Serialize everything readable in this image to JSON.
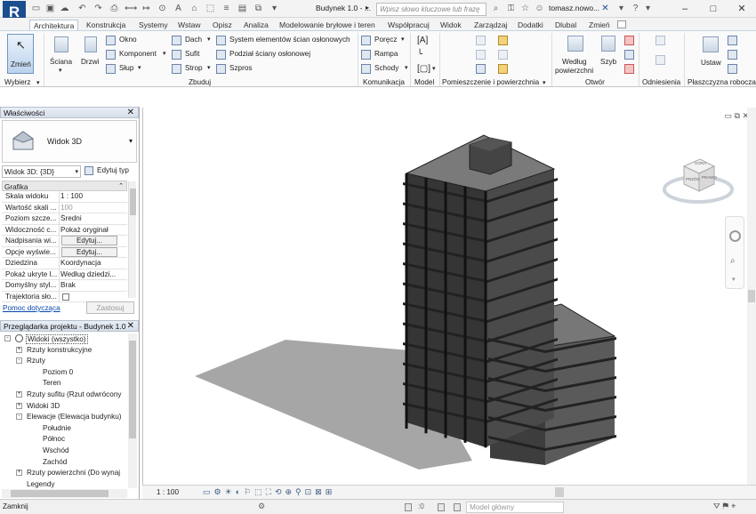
{
  "titlebar": {
    "document_title": "Budynek 1.0 - ...",
    "search_placeholder": "Wpisz słowo kluczowe lub frazę",
    "user": "tomasz.nowo...",
    "help": "?",
    "minimize": "–",
    "maximize": "□",
    "close": "✕"
  },
  "tabs": [
    "Architektura",
    "Konstrukcja",
    "Systemy",
    "Wstaw",
    "Opisz",
    "Analiza",
    "Modelowanie bryłowe i teren",
    "Współpracuj",
    "Widok",
    "Zarządzaj",
    "Dodatki",
    "Dlubal",
    "Zmień"
  ],
  "ribbon": {
    "modify": "Zmień",
    "wall": "Ściana",
    "door": "Drzwi",
    "window": "Okno",
    "component": "Komponent",
    "column": "Słup",
    "roof": "Dach",
    "ceiling": "Sufit",
    "floor": "Strop",
    "curtain_system": "System elementów ścian osłonowych",
    "curtain_grid": "Podział ściany osłonowej",
    "mullion": "Szpros",
    "railing": "Poręcz",
    "ramp": "Rampa",
    "stair": "Schody",
    "by_face": "Według",
    "by_face2": "powierzchni",
    "shaft": "Szyb",
    "set": "Ustaw",
    "groups": {
      "select": "Wybierz",
      "build": "Zbuduj",
      "circulation": "Komunikacja",
      "model": "Model",
      "room_area": "Pomieszczenie i powierzchnia",
      "opening": "Otwór",
      "datum": "Odniesienia",
      "work_plane": "Płaszczyzna robocza"
    }
  },
  "properties": {
    "title": "Właściwości",
    "type_name": "Widok 3D",
    "instance_selector": "Widok 3D: {3D}",
    "edit_type": "Edytuj typ",
    "section": "Grafika",
    "rows": [
      {
        "key": "Skala widoku",
        "value": "1 : 100",
        "kind": "text"
      },
      {
        "key": "Wartość skali ...",
        "value": "100",
        "kind": "grey"
      },
      {
        "key": "Poziom szcze...",
        "value": "Średni",
        "kind": "text"
      },
      {
        "key": "Widoczność c...",
        "value": "Pokaż oryginał",
        "kind": "text"
      },
      {
        "key": "Nadpisania wi...",
        "value": "Edytuj...",
        "kind": "button"
      },
      {
        "key": "Opcje wyświe...",
        "value": "Edytuj...",
        "kind": "button"
      },
      {
        "key": "Dziedzina",
        "value": "Koordynacja",
        "kind": "text"
      },
      {
        "key": "Pokaż ukryte l...",
        "value": "Według dziedzi...",
        "kind": "text"
      },
      {
        "key": "Domyślny styl...",
        "value": "Brak",
        "kind": "text"
      },
      {
        "key": "Trajektoria sło...",
        "value": "",
        "kind": "checkbox"
      }
    ],
    "help_link": "Pomoc dotycząca",
    "apply": "Zastosuj"
  },
  "browser": {
    "title": "Przeglądarka projektu - Budynek 1.0",
    "items": [
      {
        "label": "Widoki (wszystko)",
        "level": 0,
        "toggle": "-",
        "icon": true
      },
      {
        "label": "Rzuty konstrukcyjne",
        "level": 1,
        "toggle": "+"
      },
      {
        "label": "Rzuty",
        "level": 1,
        "toggle": "-"
      },
      {
        "label": "Poziom 0",
        "level": 2,
        "toggle": ""
      },
      {
        "label": "Teren",
        "level": 2,
        "toggle": ""
      },
      {
        "label": "Rzuty sufitu (Rzut odwrócony",
        "level": 1,
        "toggle": "+"
      },
      {
        "label": "Widoki 3D",
        "level": 1,
        "toggle": "+"
      },
      {
        "label": "Elewacje (Elewacja budynku)",
        "level": 1,
        "toggle": "-"
      },
      {
        "label": "Południe",
        "level": 2,
        "toggle": ""
      },
      {
        "label": "Północ",
        "level": 2,
        "toggle": ""
      },
      {
        "label": "Wschód",
        "level": 2,
        "toggle": ""
      },
      {
        "label": "Zachód",
        "level": 2,
        "toggle": ""
      },
      {
        "label": "Rzuty powierzchni (Do wynaj",
        "level": 1,
        "toggle": "+"
      },
      {
        "label": "Legendy",
        "level": 1,
        "toggle": ""
      }
    ]
  },
  "viewcube": {
    "top": "GÓRA",
    "front": "PRZÓD",
    "right": "PRAWO"
  },
  "viewbar": {
    "scale": "1 : 100"
  },
  "statusbar": {
    "message": "Zamknij",
    "coord": ":0",
    "model": "Model główny"
  },
  "colors": {
    "accent": "#1b4e8f",
    "link": "#0645ad"
  }
}
